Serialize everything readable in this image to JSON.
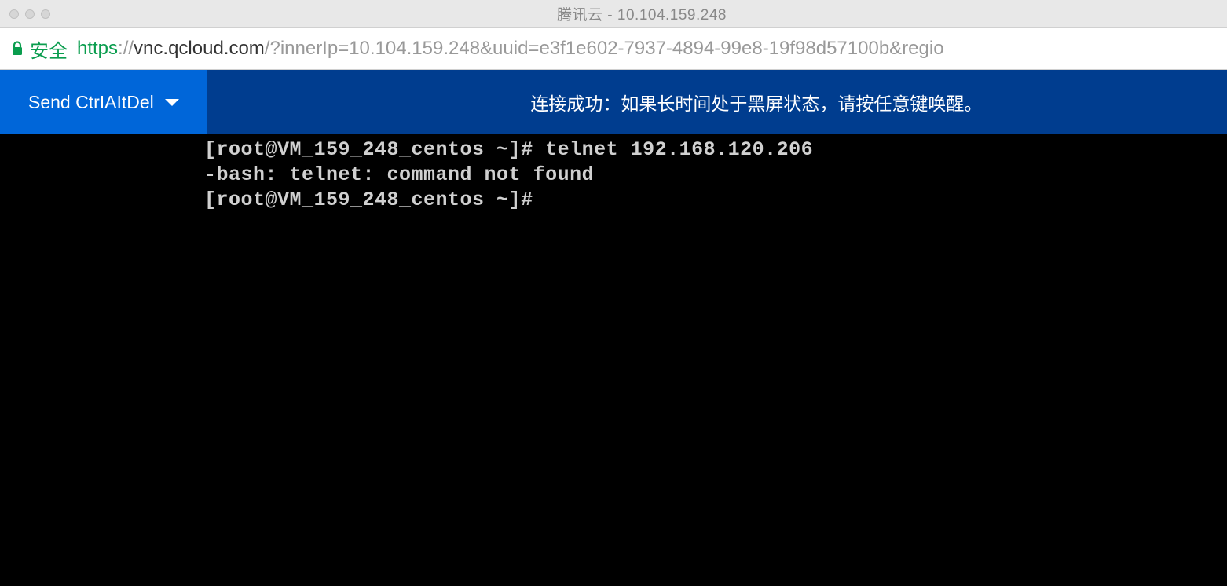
{
  "browser": {
    "window_title": "腾讯云 - 10.104.159.248",
    "secure_label": "安全",
    "url_https": "https",
    "url_separator": "://",
    "url_domain": "vnc.qcloud.com",
    "url_path": "/?innerIp=10.104.159.248&uuid=e3f1e602-7937-4894-99e8-19f98d57100b&regio"
  },
  "app": {
    "send_button_label": "Send CtrIAItDel",
    "status_message": "连接成功：如果长时间处于黑屏状态，请按任意键唤醒。"
  },
  "terminal": {
    "lines": [
      "[root@VM_159_248_centos ~]# telnet 192.168.120.206",
      "-bash: telnet: command not found",
      "[root@VM_159_248_centos ~]# "
    ]
  },
  "colors": {
    "header_dark_blue": "#003d8f",
    "button_blue": "#0066d9",
    "secure_green": "#0a9d4e"
  }
}
